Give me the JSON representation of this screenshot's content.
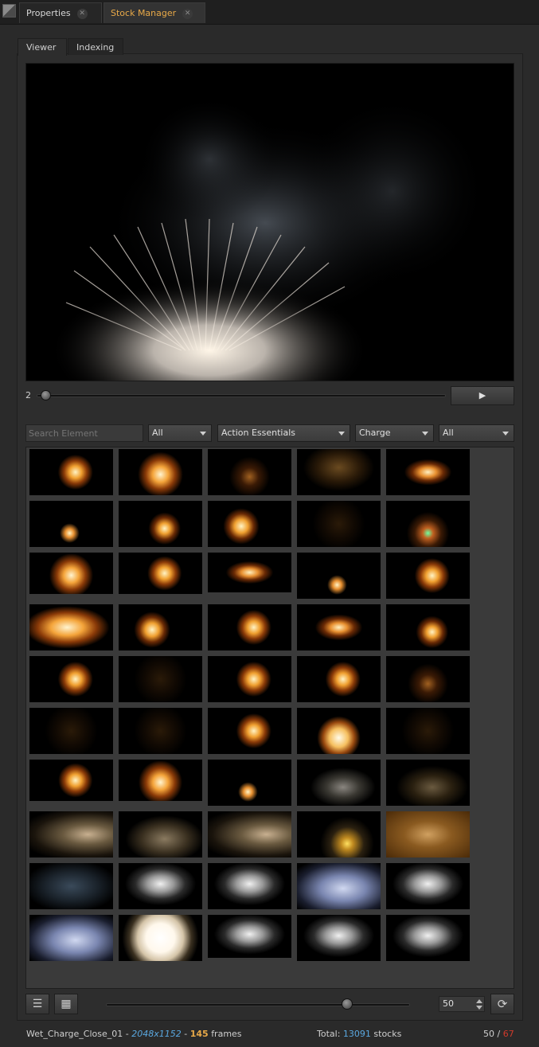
{
  "top_tabs": [
    {
      "label": "Properties",
      "active": false
    },
    {
      "label": "Stock Manager",
      "active": true
    }
  ],
  "sub_tabs": [
    {
      "label": "Viewer",
      "active": true
    },
    {
      "label": "Indexing",
      "active": false
    }
  ],
  "viewer": {
    "frame": "2",
    "play_label": "▶",
    "scrub_position": 0.02
  },
  "filters": {
    "search_placeholder": "Search Element",
    "dropdowns": [
      "All",
      "Action Essentials",
      "Charge",
      "All"
    ]
  },
  "thumbnails": [
    "orange-burst",
    "orange-explosion",
    "sparks",
    "sparks-wide",
    "fire-plume",
    "small-fire",
    "fire-burst-right",
    "fire-burst",
    "dark-sparks",
    "sparks-green",
    "orange-explosion",
    "orange-burst",
    "fire-plume",
    "small-fire",
    "orange-burst",
    "large-explosion",
    "fire-burst",
    "orange-burst",
    "fire-plume",
    "fire-burst-right",
    "orange-burst",
    "dark-sparks",
    "orange-burst",
    "orange-burst",
    "sparks",
    "dark-sparks",
    "dark-sparks",
    "orange-burst",
    "bright-explosion",
    "dark-sparks",
    "orange-burst",
    "orange-explosion",
    "small-fire",
    "smoke-column",
    "smoke-sparks",
    "dust-cloud",
    "smoke-dust",
    "dust-cloud",
    "fire-smoke",
    "dust-brown",
    "debris-blue",
    "white-smoke",
    "white-smoke",
    "blue-smoke",
    "white-smoke",
    "blue-smoke",
    "bright-flash",
    "white-smoke",
    "white-smoke",
    "white-smoke"
  ],
  "controls": {
    "list_view_icon": "list-icon",
    "grid_view_icon": "grid-icon",
    "thumb_size": 0.8,
    "per_page": "50",
    "refresh_icon": "refresh-icon"
  },
  "status": {
    "name": "Wet_Charge_Close_01",
    "sep": "-",
    "resolution": "2048x1152",
    "frames": "145",
    "frames_label": "frames",
    "total_label": "Total:",
    "total": "13091",
    "total_unit": "stocks",
    "shown": "50",
    "slash": "/",
    "available": "67"
  },
  "colors": {
    "accent_orange": "#e8a948",
    "accent_blue": "#5aa8e0",
    "accent_red": "#d03a2a"
  }
}
